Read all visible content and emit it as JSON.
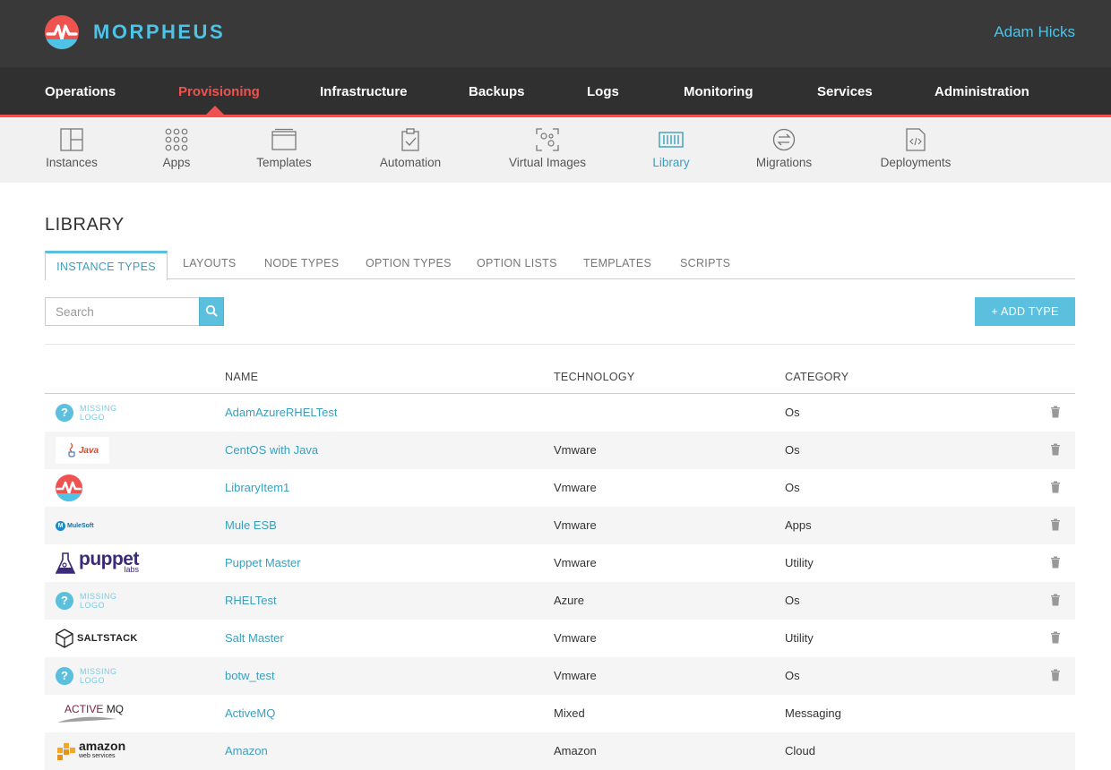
{
  "brand": {
    "name": "MORPHEUS",
    "color": "#4fc3e6",
    "logo_color": "#ef5350"
  },
  "user": {
    "name": "Adam Hicks"
  },
  "mainnav": {
    "items": [
      {
        "label": "Operations"
      },
      {
        "label": "Provisioning",
        "active": true
      },
      {
        "label": "Infrastructure"
      },
      {
        "label": "Backups"
      },
      {
        "label": "Logs"
      },
      {
        "label": "Monitoring"
      },
      {
        "label": "Services"
      },
      {
        "label": "Administration"
      }
    ]
  },
  "subnav": {
    "items": [
      {
        "label": "Instances",
        "icon": "instances-icon"
      },
      {
        "label": "Apps",
        "icon": "apps-icon"
      },
      {
        "label": "Templates",
        "icon": "templates-icon"
      },
      {
        "label": "Automation",
        "icon": "automation-icon"
      },
      {
        "label": "Virtual Images",
        "icon": "virtual-images-icon"
      },
      {
        "label": "Library",
        "icon": "library-icon",
        "active": true
      },
      {
        "label": "Migrations",
        "icon": "migrations-icon"
      },
      {
        "label": "Deployments",
        "icon": "deployments-icon"
      }
    ]
  },
  "page": {
    "title": "LIBRARY"
  },
  "tabs": [
    {
      "label": "INSTANCE TYPES",
      "active": true
    },
    {
      "label": "LAYOUTS"
    },
    {
      "label": "NODE TYPES"
    },
    {
      "label": "OPTION TYPES"
    },
    {
      "label": "OPTION LISTS"
    },
    {
      "label": "TEMPLATES"
    },
    {
      "label": "SCRIPTS"
    }
  ],
  "search": {
    "placeholder": "Search",
    "icon": "search-icon"
  },
  "add_button": {
    "label": "+ ADD TYPE"
  },
  "table": {
    "headers": {
      "name": "NAME",
      "technology": "TECHNOLOGY",
      "category": "CATEGORY"
    },
    "rows": [
      {
        "logo": "missing-logo",
        "logo_text_1": "MISSING",
        "logo_text_2": "LOGO",
        "name": "AdamAzureRHELTest",
        "technology": "",
        "category": "Os",
        "deletable": true
      },
      {
        "logo": "java-logo",
        "logo_text": "Java",
        "name": "CentOS with Java",
        "technology": "Vmware",
        "category": "Os",
        "deletable": true
      },
      {
        "logo": "morpheus-logo",
        "name": "LibraryItem1",
        "technology": "Vmware",
        "category": "Os",
        "deletable": true
      },
      {
        "logo": "mulesoft-logo",
        "logo_text": "MuleSoft",
        "name": "Mule ESB",
        "technology": "Vmware",
        "category": "Apps",
        "deletable": true
      },
      {
        "logo": "puppet-logo",
        "logo_text": "puppet",
        "logo_text_2": "labs",
        "name": "Puppet Master",
        "technology": "Vmware",
        "category": "Utility",
        "deletable": true
      },
      {
        "logo": "missing-logo",
        "logo_text_1": "MISSING",
        "logo_text_2": "LOGO",
        "name": "RHELTest",
        "technology": "Azure",
        "category": "Os",
        "deletable": true
      },
      {
        "logo": "saltstack-logo",
        "logo_text": "SALTSTACK",
        "name": "Salt Master",
        "technology": "Vmware",
        "category": "Utility",
        "deletable": true
      },
      {
        "logo": "missing-logo",
        "logo_text_1": "MISSING",
        "logo_text_2": "LOGO",
        "name": "botw_test",
        "technology": "Vmware",
        "category": "Os",
        "deletable": true
      },
      {
        "logo": "activemq-logo",
        "logo_text": "ACTIVE",
        "logo_text_2": "MQ",
        "name": "ActiveMQ",
        "technology": "Mixed",
        "category": "Messaging",
        "deletable": false
      },
      {
        "logo": "amazon-logo",
        "logo_text": "amazon",
        "logo_text_2": "web services",
        "name": "Amazon",
        "technology": "Amazon",
        "category": "Cloud",
        "deletable": false
      }
    ]
  },
  "colors": {
    "accent": "#5bc0de",
    "link": "#3a9fbf",
    "active_nav": "#ef5350",
    "topbar": "#393939"
  }
}
